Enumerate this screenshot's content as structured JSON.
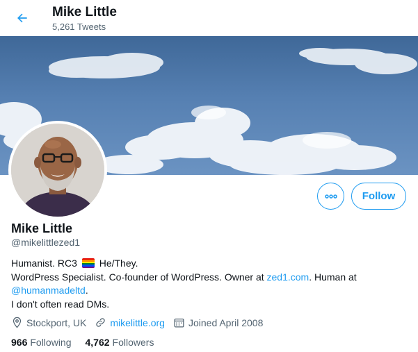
{
  "header": {
    "back_icon": "arrow-left-icon",
    "title": "Mike Little",
    "tweet_count": "5,261 Tweets"
  },
  "profile": {
    "name": "Mike Little",
    "handle": "@mikelittlezed1",
    "more_icon": "more-dots-icon",
    "follow_label": "Follow",
    "bio": {
      "line1_a": "Humanist. RC3",
      "line1_b": "He/They.",
      "line2_a": "WordPress Specialist. Co-founder of WordPress. Owner at",
      "line2_link": "zed1.com",
      "line2_b": ". Human at",
      "line3_link": "@humanmadeltd",
      "line3_b": ".",
      "line4": "I don't often read DMs."
    },
    "location": "Stockport, UK",
    "website": "mikelittle.org",
    "joined": "Joined April 2008",
    "following_count": "966",
    "following_label": "Following",
    "followers_count": "4,762",
    "followers_label": "Followers"
  },
  "colors": {
    "accent": "#1d9bf0",
    "text": "#0f1419",
    "secondary": "#536471"
  }
}
